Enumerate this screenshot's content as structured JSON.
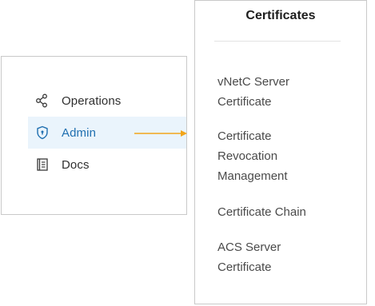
{
  "sidebar": {
    "items": [
      {
        "label": "Operations",
        "icon": "share-nodes-icon"
      },
      {
        "label": "Admin",
        "icon": "shield-icon",
        "active": true
      },
      {
        "label": "Docs",
        "icon": "book-icon"
      }
    ]
  },
  "certificates": {
    "title": "Certificates",
    "items": [
      {
        "label": "vNetC Server\nCertificate"
      },
      {
        "label": "Certificate\nRevocation\nManagement"
      },
      {
        "label": "Certificate Chain"
      },
      {
        "label": "ACS Server\nCertificate"
      }
    ]
  },
  "colors": {
    "accent": "#1f6fb0",
    "active_bg": "#eaf4fc",
    "arrow": "#f2a51a",
    "border": "#c9c9c9"
  }
}
